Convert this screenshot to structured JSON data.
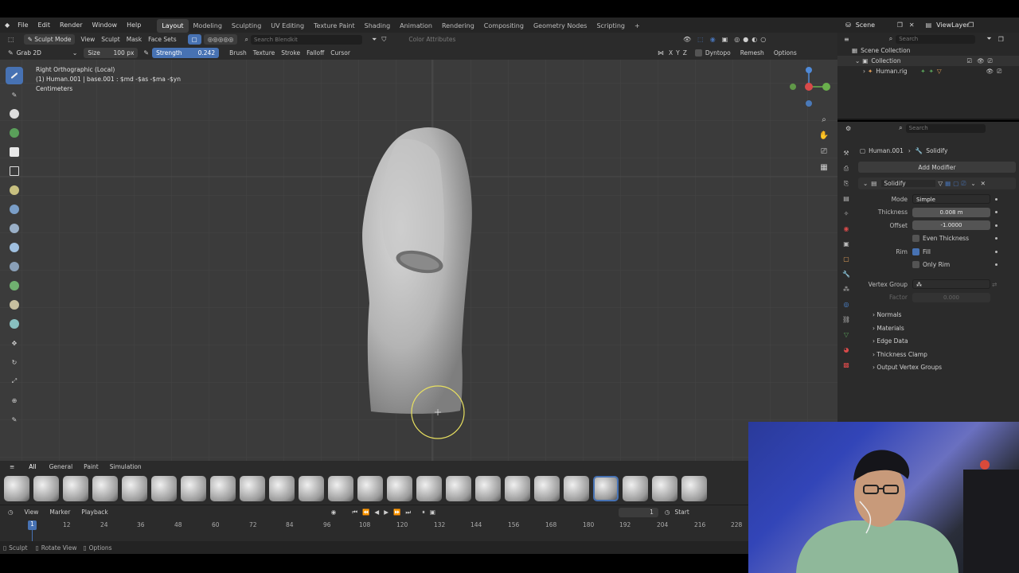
{
  "menu": {
    "items": [
      "File",
      "Edit",
      "Render",
      "Window",
      "Help"
    ]
  },
  "workspaces": [
    "Layout",
    "Modeling",
    "Sculpting",
    "UV Editing",
    "Texture Paint",
    "Shading",
    "Animation",
    "Rendering",
    "Compositing",
    "Geometry Nodes",
    "Scripting"
  ],
  "active_workspace": "Layout",
  "scene_label": "Scene",
  "viewlayer_label": "ViewLayer",
  "header1": {
    "mode": "Sculpt Mode",
    "menus": [
      "View",
      "Sculpt",
      "Mask",
      "Face Sets"
    ],
    "search_placeholder": "Search Blendkit",
    "color_attributes": "Color Attributes"
  },
  "header2": {
    "brush": "Grab 2D",
    "size_label": "Size",
    "size_value": "100 px",
    "strength_label": "Strength",
    "strength_value": "0.242",
    "menus": [
      "Brush",
      "Texture",
      "Stroke",
      "Falloff",
      "Cursor"
    ],
    "axes": [
      "X",
      "Y",
      "Z"
    ],
    "dyntopo": "Dyntopo",
    "remesh": "Remesh",
    "options": "Options"
  },
  "overlay": {
    "view": "Right Orthographic (Local)",
    "object": "(1) Human.001 | base.001 : $md -$as -$ma -$yn",
    "units": "Centimeters"
  },
  "outliner": {
    "search_placeholder": "Search",
    "scene_collection": "Scene Collection",
    "collection": "Collection",
    "object": "Human.rig"
  },
  "properties": {
    "search_placeholder": "Search",
    "breadcrumb_object": "Human.001",
    "breadcrumb_modifier": "Solidify",
    "add_modifier": "Add Modifier",
    "modifier_name": "Solidify",
    "mode_label": "Mode",
    "mode_value": "Simple",
    "thickness_label": "Thickness",
    "thickness_value": "0.008 m",
    "offset_label": "Offset",
    "offset_value": "-1.0000",
    "even_thickness": "Even Thickness",
    "rim_label": "Rim",
    "fill": "Fill",
    "only_rim": "Only Rim",
    "vertex_group_label": "Vertex Group",
    "factor_label": "Factor",
    "factor_value": "0.000",
    "subpanels": [
      "Normals",
      "Materials",
      "Edge Data",
      "Thickness Clamp",
      "Output Vertex Groups"
    ]
  },
  "asset_tabs": [
    "All",
    "General",
    "Paint",
    "Simulation"
  ],
  "timeline": {
    "menus": [
      "View",
      "Marker",
      "Playback"
    ],
    "current_frame": "1",
    "start_label": "Start",
    "ticks": [
      "12",
      "24",
      "36",
      "48",
      "60",
      "72",
      "84",
      "96",
      "108",
      "120",
      "132",
      "144",
      "156",
      "168",
      "180",
      "192",
      "204",
      "216",
      "228"
    ],
    "playhead": "1"
  },
  "status": {
    "items": [
      "Sculpt",
      "Rotate View",
      "Options"
    ]
  },
  "colors": {
    "accent": "#4772b3",
    "viewport": "#3b3b3b",
    "panel": "#2b2b2b"
  }
}
